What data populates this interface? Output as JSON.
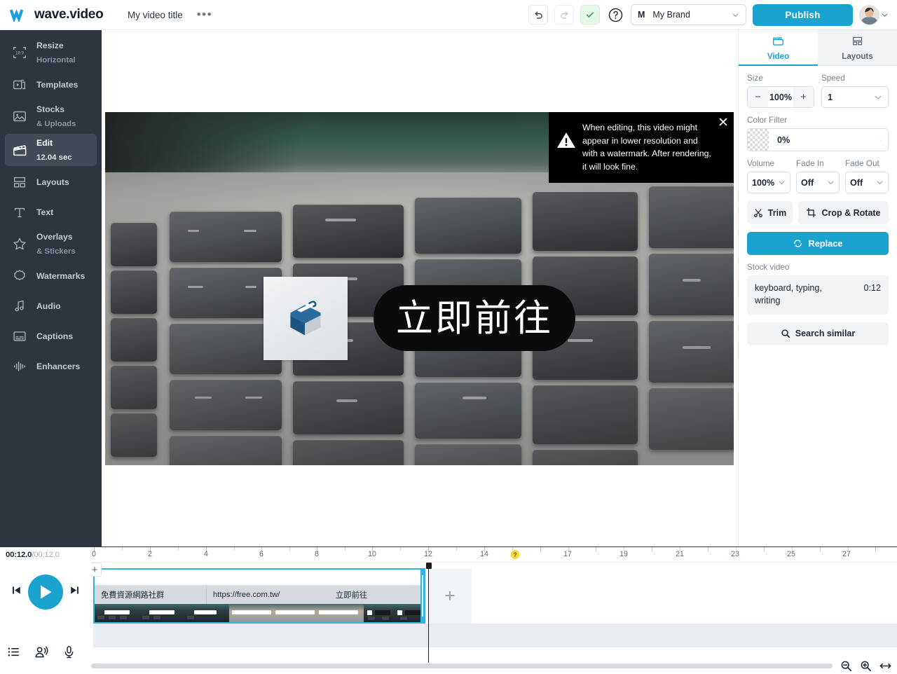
{
  "topbar": {
    "logo_text": "wave.video",
    "video_title": "My video title",
    "more_dots": "•••",
    "undo_icon": "undo-icon",
    "redo_icon": "redo-icon",
    "saved_icon": "check-icon",
    "help_icon": "question-icon",
    "brand_initial": "M",
    "brand_name": "My Brand",
    "publish_label": "Publish",
    "accent_color": "#1aa3cf"
  },
  "sidebar": {
    "items": [
      {
        "label": "Resize",
        "sub": "Horizontal",
        "icon": "resize-icon",
        "active": false
      },
      {
        "label": "Templates",
        "sub": "",
        "icon": "templates-icon",
        "active": false
      },
      {
        "label": "Stocks",
        "sub": "& Uploads",
        "icon": "image-icon",
        "active": false
      },
      {
        "label": "Edit",
        "sub": "12.04 sec",
        "icon": "clapper-icon",
        "active": true
      },
      {
        "label": "Layouts",
        "sub": "",
        "icon": "layouts-icon",
        "active": false
      },
      {
        "label": "Text",
        "sub": "",
        "icon": "text-icon",
        "active": false
      },
      {
        "label": "Overlays",
        "sub": "& Stickers",
        "icon": "star-icon",
        "active": false
      },
      {
        "label": "Watermarks",
        "sub": "",
        "icon": "badge-icon",
        "active": false
      },
      {
        "label": "Audio",
        "sub": "",
        "icon": "music-icon",
        "active": false
      },
      {
        "label": "Captions",
        "sub": "",
        "icon": "captions-icon",
        "active": false
      },
      {
        "label": "Enhancers",
        "sub": "",
        "icon": "waveform-icon",
        "active": false
      }
    ]
  },
  "canvas": {
    "notice": {
      "text": "When editing, this video might appear in lower resolution and with a watermark. After rendering, it will look fine.",
      "warn_icon": "warning-icon",
      "close_icon": "close-icon"
    },
    "overlay_cta_text": "立即前往",
    "logo_card_icon": "box-logo-icon"
  },
  "right_panel": {
    "tabs": [
      {
        "label": "Video",
        "icon": "clapper-icon",
        "active": true
      },
      {
        "label": "Layouts",
        "icon": "layouts-icon",
        "active": false
      }
    ],
    "size_label": "Size",
    "size_value": "100%",
    "size_minus": "−",
    "size_plus": "+",
    "speed_label": "Speed",
    "speed_value": "1",
    "color_filter_label": "Color Filter",
    "color_filter_value": "0%",
    "volume_label": "Volume",
    "volume_value": "100%",
    "fade_in_label": "Fade In",
    "fade_in_value": "Off",
    "fade_out_label": "Fade Out",
    "fade_out_value": "Off",
    "trim_label": "Trim",
    "crop_rotate_label": "Crop & Rotate",
    "replace_label": "Replace",
    "stock_video_label": "Stock video",
    "stock_item_title": "keyboard, typing, writing",
    "stock_item_duration": "0:12",
    "search_similar_label": "Search similar"
  },
  "timeline": {
    "current_time": "00:12.0",
    "total_time": "/00:12.0",
    "ruler_labels": [
      "0",
      "2",
      "4",
      "6",
      "8",
      "10",
      "12",
      "14",
      "17",
      "19",
      "21",
      "23",
      "25",
      "27"
    ],
    "ruler_marker_icon": "question-marker",
    "play_icon": "play-icon",
    "skip_back_icon": "skip-back-icon",
    "skip_forward_icon": "skip-forward-icon",
    "list_icon": "list-icon",
    "voiceover_icon": "voiceover-icon",
    "mic_icon": "mic-icon",
    "clip_text_1": "免費資源網路社群",
    "clip_text_2": "https://free.com.tw/",
    "clip_text_3": "立即前往",
    "add_clip_label": "+",
    "add_layer_label": "+",
    "zoom_out_icon": "zoom-out-icon",
    "zoom_in_icon": "zoom-in-icon",
    "fit_icon": "fit-width-icon"
  }
}
